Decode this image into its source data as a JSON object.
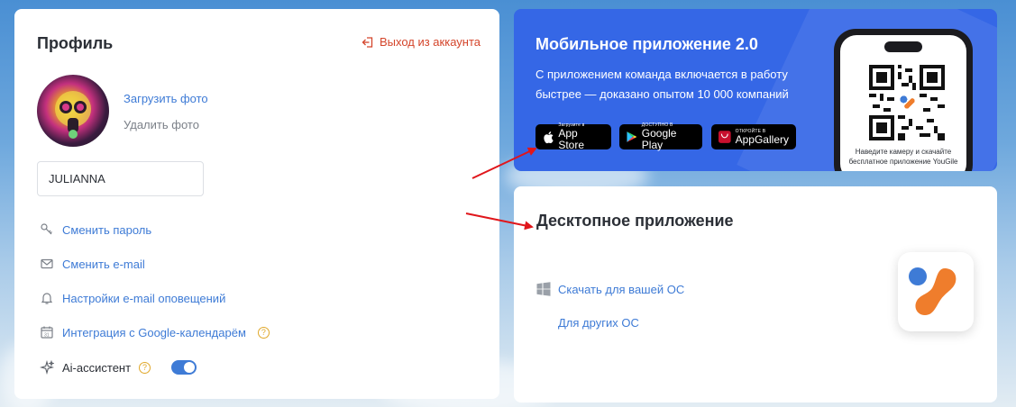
{
  "profile": {
    "title": "Профиль",
    "logout_label": "Выход из аккаунта",
    "upload_photo": "Загрузить фото",
    "delete_photo": "Удалить фото",
    "name_value": "JULIANNA",
    "menu": [
      {
        "label": "Сменить пароль",
        "icon": "key-icon"
      },
      {
        "label": "Сменить e-mail",
        "icon": "mail-icon"
      },
      {
        "label": "Настройки e-mail оповещений",
        "icon": "bell-icon"
      },
      {
        "label": "Интеграция с Google-календарём",
        "icon": "calendar-icon",
        "help": "?"
      }
    ],
    "ai": {
      "label": "Ai-ассистент",
      "help": "?",
      "enabled": true
    }
  },
  "mobile": {
    "title": "Мобильное приложение 2.0",
    "description": "С приложением команда включается в работу быстрее — доказано опытом 10 000 компаний",
    "stores": [
      {
        "small": "Загрузите в",
        "big": "App Store",
        "icon": "apple-icon"
      },
      {
        "small": "ДОСТУПНО В",
        "big": "Google Play",
        "icon": "google-play-icon"
      },
      {
        "small": "ОТКРОЙТЕ В",
        "big": "AppGallery",
        "icon": "huawei-icon"
      }
    ],
    "qr_caption": "Наведите камеру и скачайте бесплатное приложение YouGile"
  },
  "desktop": {
    "title": "Десктопное приложение",
    "download_label": "Скачать для вашей ОС",
    "other_os_label": "Для других ОС"
  },
  "colors": {
    "accent": "#3e7bd6",
    "logout": "#d4452b",
    "mobile_bg": "#3567e6",
    "annotation_arrow": "#e0161b"
  }
}
